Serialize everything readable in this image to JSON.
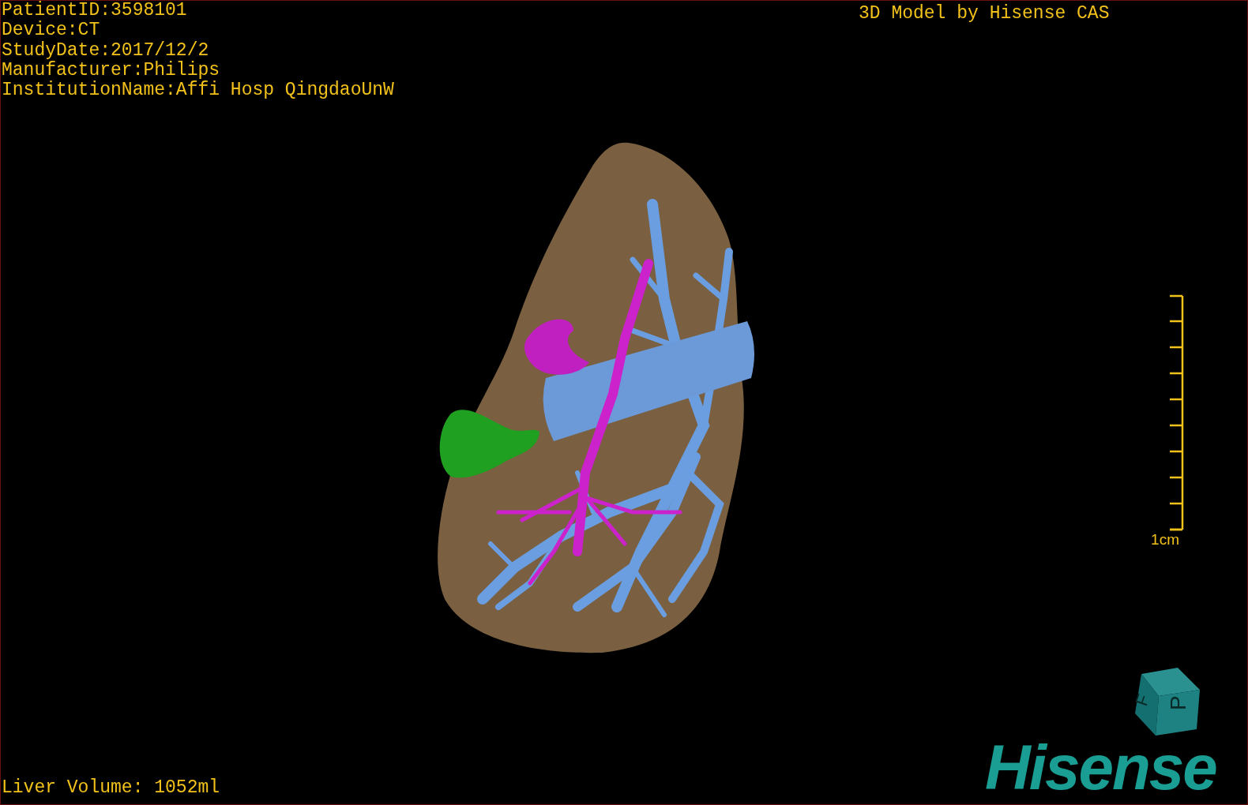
{
  "patient_info": [
    "PatientID:3598101",
    "Device:CT",
    "StudyDate:2017/12/2",
    "Manufacturer:Philips",
    "InstitutionName:Affi Hosp QingdaoUnW"
  ],
  "model_title": "3D Model by Hisense CAS",
  "scale_bar": {
    "label": "1cm"
  },
  "orientation_cube": {
    "faces": [
      "F",
      "P"
    ]
  },
  "logo": "Hisense",
  "liver_volume": "Liver Volume: 1052ml"
}
